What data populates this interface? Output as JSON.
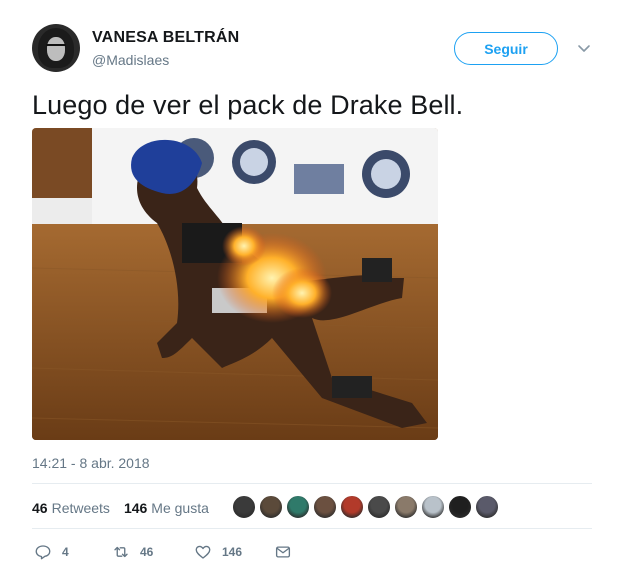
{
  "user": {
    "name": "VANESA BELTRÁN",
    "handle": "@Madislaes"
  },
  "follow_label": "Seguir",
  "tweet": {
    "text": "Luego de ver el pack de Drake Bell.",
    "timestamp": "14:21 - 8 abr. 2018"
  },
  "stats": {
    "retweets_count": "46",
    "retweets_label": "Retweets",
    "likes_count": "146",
    "likes_label": "Me gusta"
  },
  "liker_avatar_colors": [
    "#3a3a3a",
    "#5b4a3a",
    "#2f7a6a",
    "#6b5040",
    "#b23a2a",
    "#4a4a4a",
    "#8a7a6a",
    "#b9c2ca",
    "#1f1f1f",
    "#5a5a6a"
  ],
  "actions": {
    "reply_count": "4",
    "retweet_count": "46",
    "like_count": "146"
  },
  "colors": {
    "accent": "#1da1f2",
    "secondary_text": "#657786",
    "divider": "#e6ecf0"
  }
}
